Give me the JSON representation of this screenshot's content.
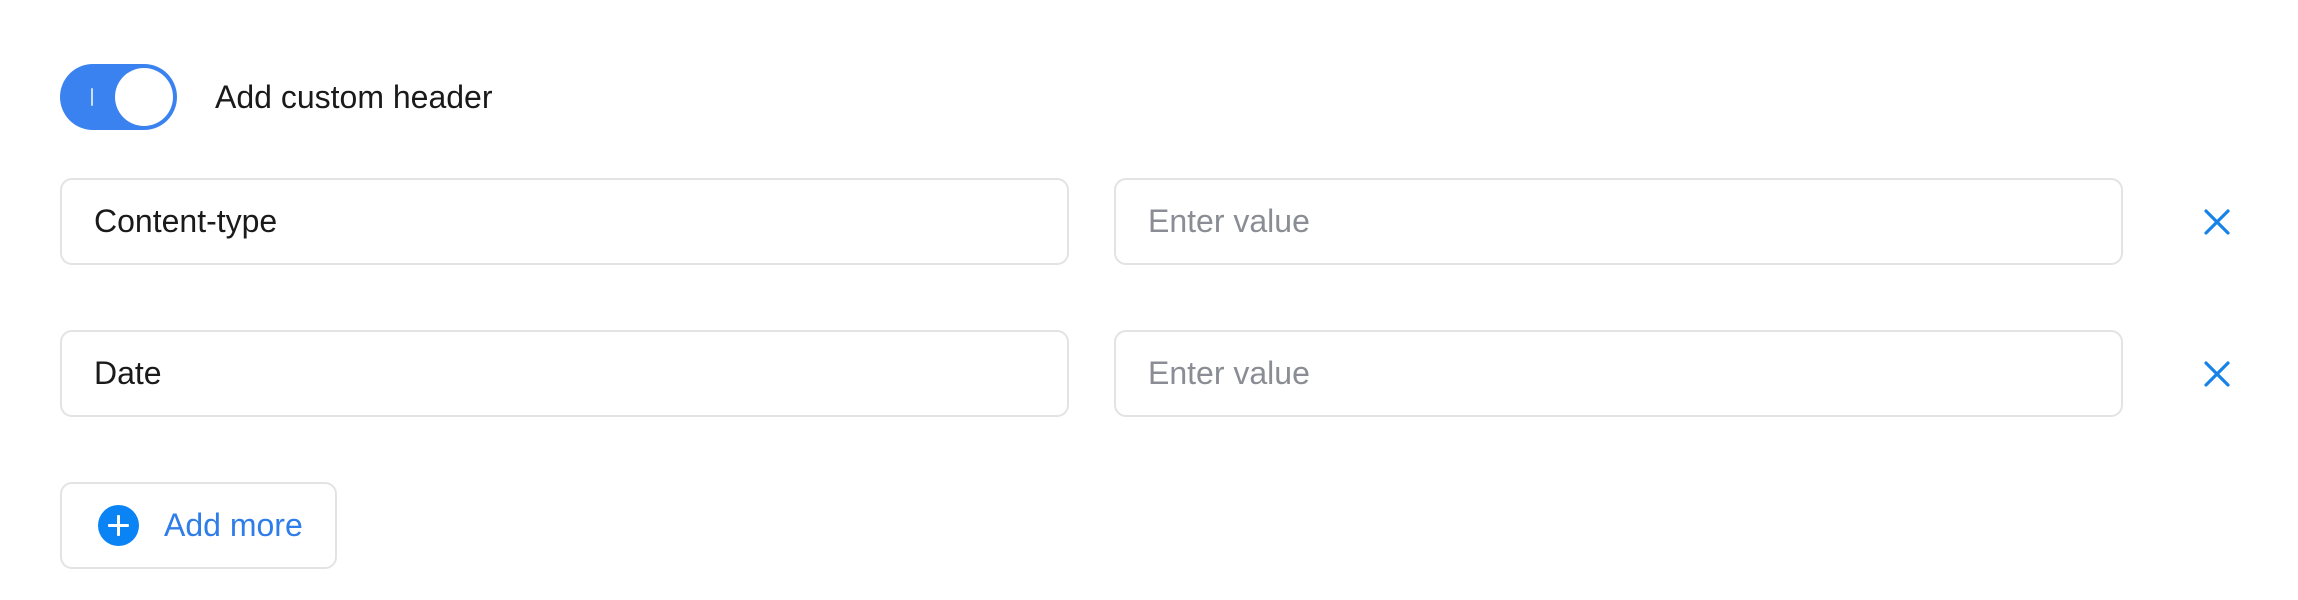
{
  "custom_header": {
    "toggle_label": "Add custom header",
    "enabled": true,
    "rows": [
      {
        "name": "Content-type",
        "value": "",
        "value_placeholder": "Enter value"
      },
      {
        "name": "Date",
        "value": "",
        "value_placeholder": "Enter value"
      }
    ],
    "add_more_label": "Add more"
  },
  "icons": {
    "remove": "close-icon",
    "add": "plus-circle-icon"
  },
  "colors": {
    "accent": "#3a82f0",
    "icon_blue": "#0a84f5",
    "link_text": "#2f7de8",
    "border": "#e3e3e6",
    "placeholder": "#8a8d93"
  }
}
